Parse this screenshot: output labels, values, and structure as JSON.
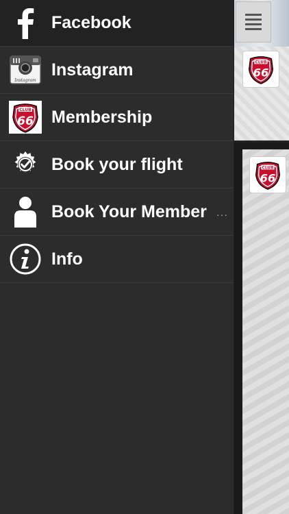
{
  "menu": {
    "items": [
      {
        "label": "Facebook",
        "icon": "facebook-icon"
      },
      {
        "label": "Instagram",
        "icon": "instagram-icon"
      },
      {
        "label": "Membership",
        "icon": "club66-logo-icon"
      },
      {
        "label": "Book your flight",
        "icon": "checkmark-badge-icon"
      },
      {
        "label": "Book Your Member",
        "icon": "person-icon"
      },
      {
        "label": "Info",
        "icon": "info-icon"
      }
    ],
    "truncation_marker": "···"
  },
  "content": {
    "logo_text_top": "CLUB",
    "logo_text_main": "66"
  },
  "colors": {
    "drawer_bg": "#2c2c2c",
    "text": "#ffffff",
    "logo_red": "#c8102e"
  }
}
